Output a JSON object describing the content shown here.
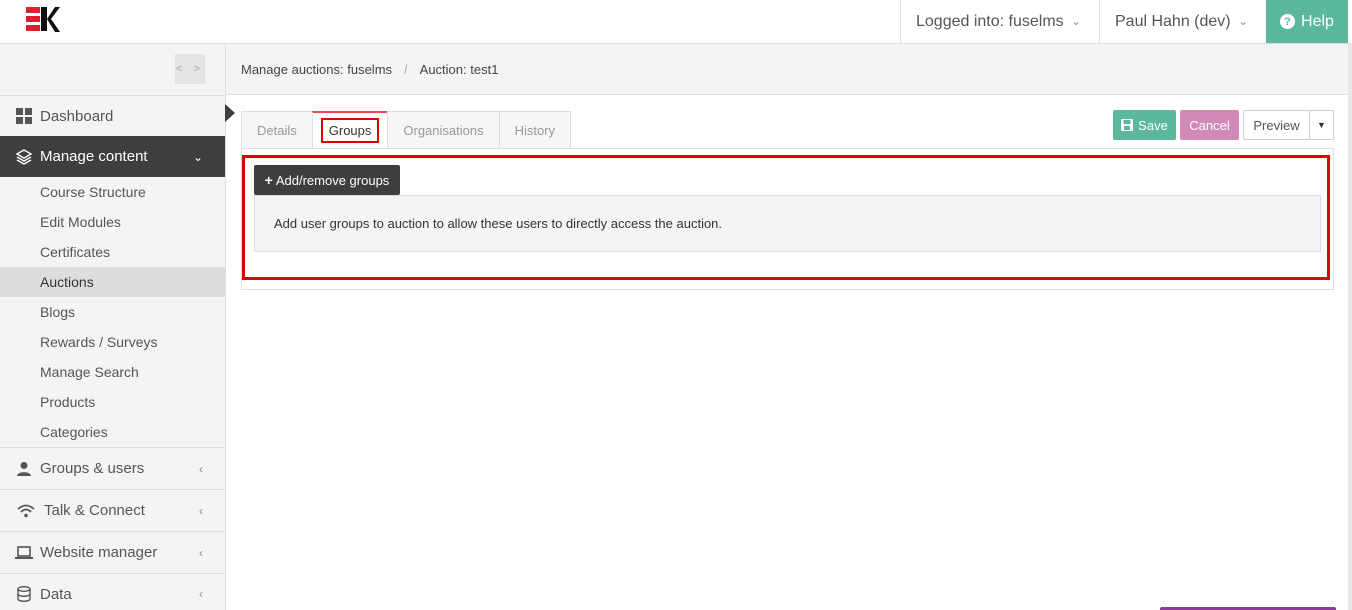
{
  "topbar": {
    "logged_into": "Logged into: fuselms",
    "user": "Paul Hahn (dev)",
    "help": "Help",
    "brand_colors": {
      "logo_red": "#d4242f",
      "logo_black": "#111111",
      "help_bg": "#5cb89d"
    }
  },
  "sidebar": {
    "collapse_glyph": "< >",
    "dashboard": "Dashboard",
    "manage_content": "Manage content",
    "sub_items": [
      "Course Structure",
      "Edit Modules",
      "Certificates",
      "Auctions",
      "Blogs",
      "Rewards / Surveys",
      "Manage Search",
      "Products",
      "Categories"
    ],
    "groups": [
      {
        "label": "Groups & users",
        "icon": "user-icon"
      },
      {
        "label": "Talk & Connect",
        "icon": "wifi-icon"
      },
      {
        "label": "Website manager",
        "icon": "laptop-icon"
      },
      {
        "label": "Data",
        "icon": "database-icon"
      }
    ]
  },
  "breadcrumb": {
    "first": "Manage auctions: fuselms",
    "separator": "/",
    "second": "Auction: test1"
  },
  "tabs": [
    "Details",
    "Groups",
    "Organisations",
    "History"
  ],
  "actions": {
    "save": "Save",
    "cancel": "Cancel",
    "preview": "Preview"
  },
  "groups_tab": {
    "add_button": "Add/remove groups",
    "info": "Add user groups to auction to allow these users to directly access the auction."
  }
}
